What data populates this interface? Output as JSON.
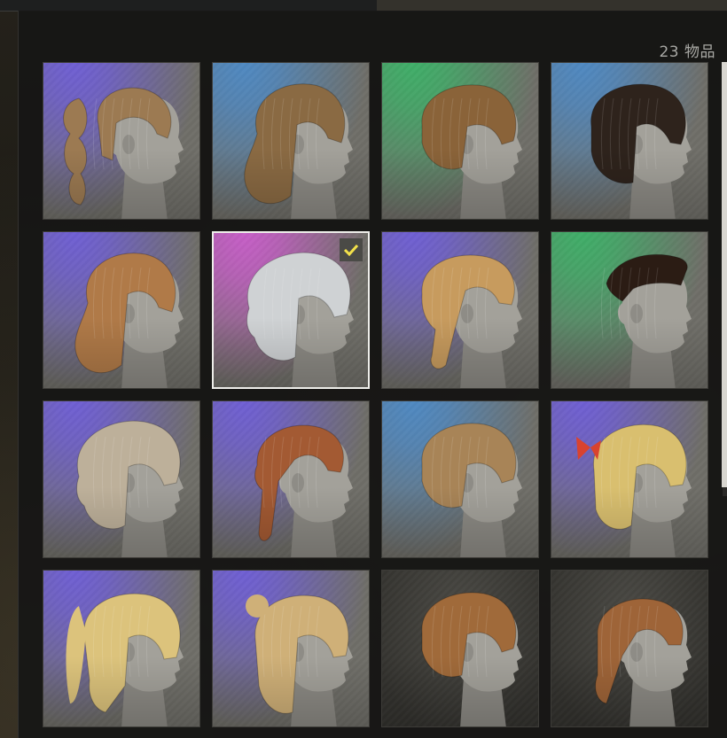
{
  "inventory": {
    "item_count_label": "23 物品",
    "selected_index": 5,
    "items": [
      {
        "name": "pigtail-bun-hair-icon",
        "bg": "purple",
        "hair": "#9c7a52",
        "style": "pigtails"
      },
      {
        "name": "long-wavy-hair-icon",
        "bg": "blue",
        "hair": "#8a6a43",
        "style": "wavy"
      },
      {
        "name": "swept-bob-hair-icon",
        "bg": "green",
        "hair": "#8a6339",
        "style": "bob"
      },
      {
        "name": "dark-highlight-hair-icon",
        "bg": "blue",
        "hair": "#2e231c",
        "style": "dark-bob"
      },
      {
        "name": "wavy-bangs-hair-icon",
        "bg": "purple",
        "hair": "#b07a48",
        "style": "wavy"
      },
      {
        "name": "silver-shag-hair-icon",
        "bg": "pink",
        "hair": "#cfd2d4",
        "style": "shag"
      },
      {
        "name": "crown-braid-hair-icon",
        "bg": "purple",
        "hair": "#c79b5e",
        "style": "braid"
      },
      {
        "name": "undercut-hair-icon",
        "bg": "green",
        "hair": "#2b1c14",
        "style": "undercut"
      },
      {
        "name": "platinum-shag-hair-icon",
        "bg": "purple",
        "hair": "#bdb09a",
        "style": "shag"
      },
      {
        "name": "side-braid-hair-icon",
        "bg": "purple",
        "hair": "#a35a33",
        "style": "side-braid"
      },
      {
        "name": "messy-bob-hair-icon",
        "bg": "blue",
        "hair": "#a88457",
        "style": "bob"
      },
      {
        "name": "blonde-bow-hair-icon",
        "bg": "purple",
        "hair": "#d9bf6f",
        "style": "bow"
      },
      {
        "name": "blonde-ponytail-bangs-hair-icon",
        "bg": "purple",
        "hair": "#dcc37c",
        "style": "pony-bangs"
      },
      {
        "name": "half-up-bun-hair-icon",
        "bg": "purple",
        "hair": "#cfb078",
        "style": "half-bun"
      },
      {
        "name": "short-bob-locked-hair-icon",
        "bg": "dark",
        "hair": "#a06a3a",
        "style": "bob"
      },
      {
        "name": "ponytail-locked-hair-icon",
        "bg": "dark",
        "hair": "#9e6438",
        "style": "pony"
      }
    ]
  },
  "colors": {
    "purple": "#6f5fd4",
    "blue": "#4f89c2",
    "green": "#3fae68",
    "pink": "#c65ec7",
    "dark": "#3a3935",
    "tile_base": "#6f6e68",
    "check_mark": "#f2e14a"
  }
}
